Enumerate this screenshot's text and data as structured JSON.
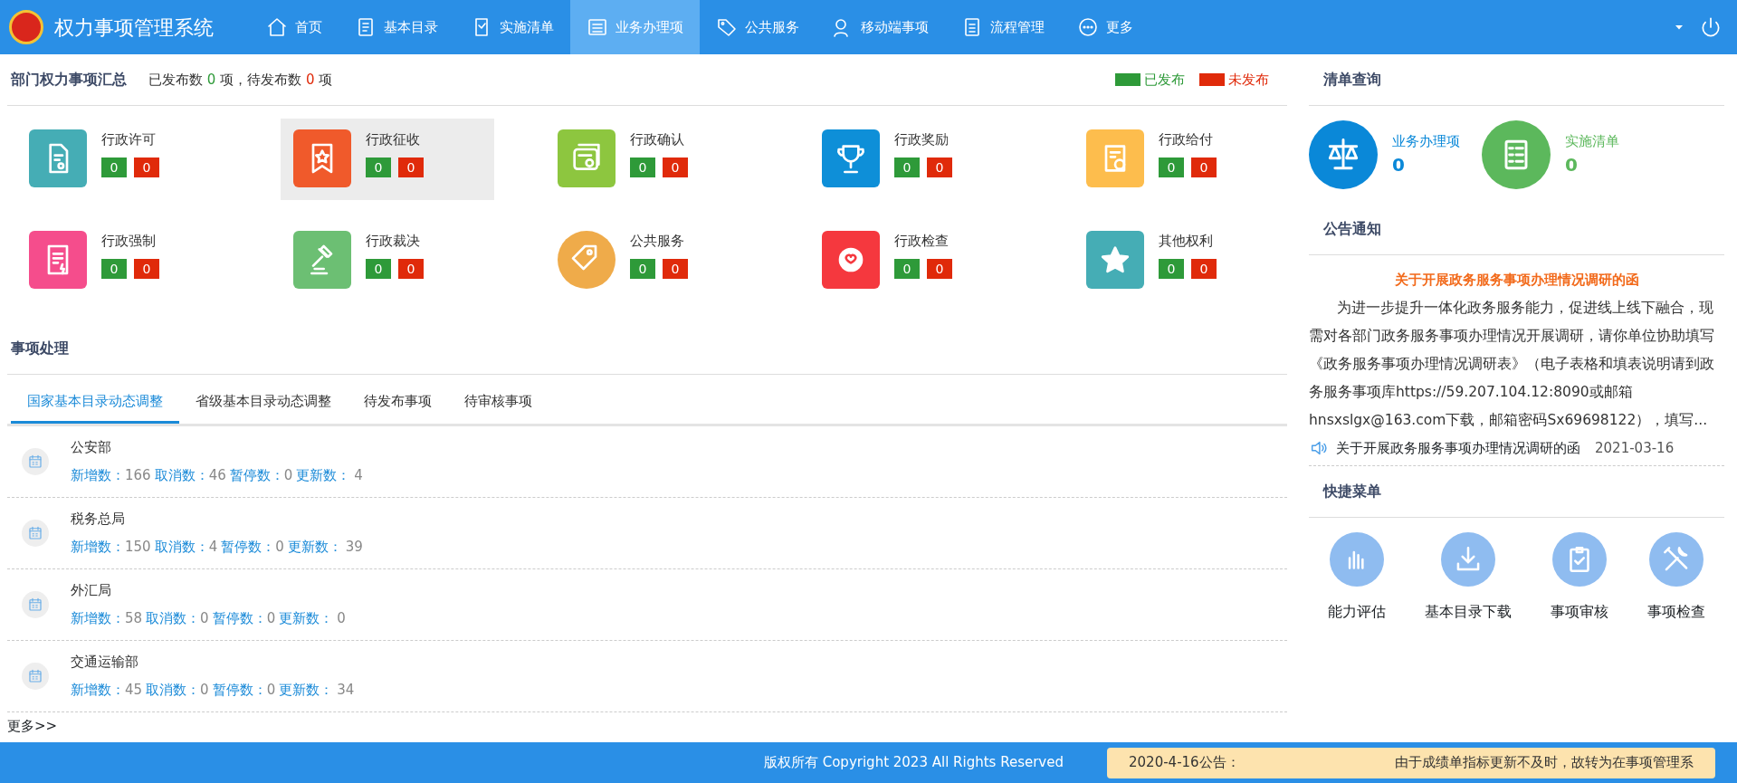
{
  "header": {
    "title": "权力事项管理系统",
    "nav": [
      {
        "label": "首页",
        "selected": false
      },
      {
        "label": "基本目录",
        "selected": false
      },
      {
        "label": "实施清单",
        "selected": false
      },
      {
        "label": "业务办理项",
        "selected": true
      },
      {
        "label": "公共服务",
        "selected": false
      },
      {
        "label": "移动端事项",
        "selected": false
      },
      {
        "label": "流程管理",
        "selected": false
      },
      {
        "label": "更多",
        "selected": false
      }
    ]
  },
  "summary": {
    "title": "部门权力事项汇总",
    "published_prefix": "已发布数",
    "published": "0",
    "middle": "项，待发布数",
    "pending": "0",
    "suffix": "项",
    "legend": [
      {
        "label": "已发布",
        "color": "#2e9a39"
      },
      {
        "label": "未发布",
        "color": "#e02a0a"
      }
    ],
    "categories": [
      {
        "name": "行政许可",
        "color": "#45adb5",
        "published": "0",
        "pending": "0",
        "selected": false
      },
      {
        "name": "行政征收",
        "color": "#f05a2b",
        "published": "0",
        "pending": "0",
        "selected": true
      },
      {
        "name": "行政确认",
        "color": "#8dc63f",
        "published": "0",
        "pending": "0",
        "selected": false
      },
      {
        "name": "行政奖励",
        "color": "#0e8fd8",
        "published": "0",
        "pending": "0",
        "selected": false
      },
      {
        "name": "行政给付",
        "color": "#fdbd4d",
        "published": "0",
        "pending": "0",
        "selected": false
      },
      {
        "name": "行政强制",
        "color": "#f54d8c",
        "published": "0",
        "pending": "0",
        "selected": false
      },
      {
        "name": "行政裁决",
        "color": "#6cbf73",
        "published": "0",
        "pending": "0",
        "selected": false
      },
      {
        "name": "公共服务",
        "color": "#efab4a",
        "published": "0",
        "pending": "0",
        "selected": false
      },
      {
        "name": "行政检查",
        "color": "#f5383e",
        "published": "0",
        "pending": "0",
        "selected": false
      },
      {
        "name": "其他权利",
        "color": "#45adb5",
        "published": "0",
        "pending": "0",
        "selected": false
      }
    ]
  },
  "processing": {
    "title": "事项处理",
    "tabs": [
      {
        "label": "国家基本目录动态调整",
        "selected": true
      },
      {
        "label": "省级基本目录动态调整",
        "selected": false
      },
      {
        "label": "待发布事项",
        "selected": false
      },
      {
        "label": "待审核事项",
        "selected": false
      }
    ],
    "rows": [
      {
        "name": "公安部",
        "stats": [
          {
            "label": "新增数：",
            "value": "166"
          },
          {
            "label": "取消数：",
            "value": "46"
          },
          {
            "label": "暂停数：",
            "value": "0"
          },
          {
            "label": "更新数：",
            "value": "4"
          }
        ]
      },
      {
        "name": "税务总局",
        "stats": [
          {
            "label": "新增数：",
            "value": "150"
          },
          {
            "label": "取消数：",
            "value": "4"
          },
          {
            "label": "暂停数：",
            "value": "0"
          },
          {
            "label": "更新数：",
            "value": "39"
          }
        ]
      },
      {
        "name": "外汇局",
        "stats": [
          {
            "label": "新增数：",
            "value": "58"
          },
          {
            "label": "取消数：",
            "value": "0"
          },
          {
            "label": "暂停数：",
            "value": "0"
          },
          {
            "label": "更新数：",
            "value": "0"
          }
        ]
      },
      {
        "name": "交通运输部",
        "stats": [
          {
            "label": "新增数：",
            "value": "45"
          },
          {
            "label": "取消数：",
            "value": "0"
          },
          {
            "label": "暂停数：",
            "value": "0"
          },
          {
            "label": "更新数：",
            "value": "34"
          }
        ]
      }
    ],
    "more": "更多>>"
  },
  "list_query": {
    "title": "清单查询",
    "items": [
      {
        "label": "业务办理项",
        "count": "0",
        "color": "#0a88d8"
      },
      {
        "label": "实施清单",
        "count": "0",
        "color": "#5cb85c"
      }
    ]
  },
  "notice": {
    "title": "公告通知",
    "headline": "关于开展政务服务事项办理情况调研的函",
    "body": "为进一步提升一体化政务服务能力，促进线上线下融合，现需对各部门政务服务事项办理情况开展调研，请你单位协助填写《政务服务事项办理情况调研表》（电子表格和填表说明请到政务服务事项库https://59.207.104.12:8090或邮箱hnsxslgx@163.com下载，邮箱密码Sx69698122），填写...",
    "item": {
      "title": "关于开展政务服务事项办理情况调研的函",
      "date": "2021-03-16"
    }
  },
  "quick_menu": {
    "title": "快捷菜单",
    "items": [
      "能力评估",
      "基本目录下载",
      "事项审核",
      "事项检查"
    ]
  },
  "footer": {
    "copyright": "版权所有 Copyright 2023 All Rights Reserved",
    "notice_label": "2020-4-16公告：",
    "notice_text": "由于成绩单指标更新不及时，故转为在事项管理系"
  }
}
